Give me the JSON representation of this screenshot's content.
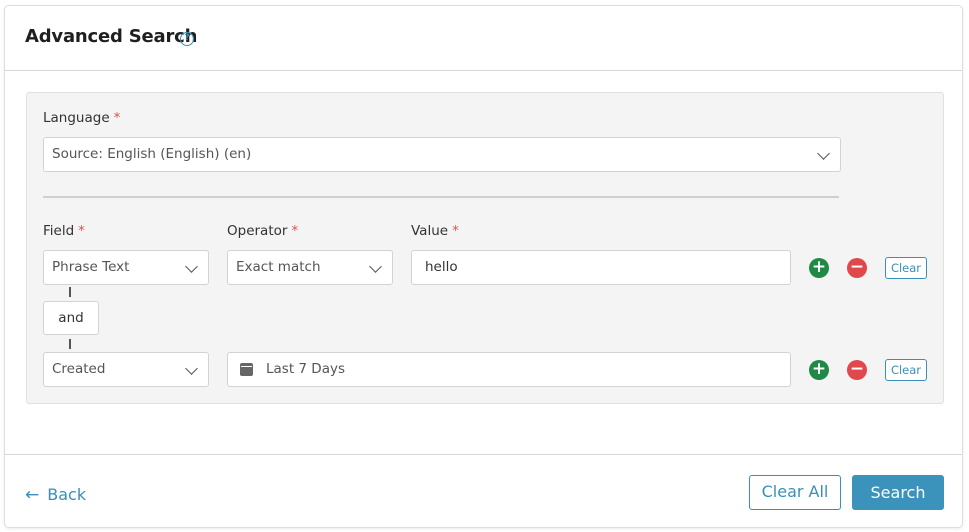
{
  "header": {
    "title": "Advanced Search",
    "help_icon": "?"
  },
  "language": {
    "label": "Language",
    "required_mark": "*",
    "value": "Source: English (English) (en)"
  },
  "columns": {
    "field": "Field",
    "operator": "Operator",
    "value": "Value",
    "required_mark": "*"
  },
  "rows": [
    {
      "field": "Phrase Text",
      "operator": "Exact match",
      "value": "hello",
      "add_icon": "+",
      "remove_icon": "−",
      "clear_label": "Clear"
    },
    {
      "field": "Created",
      "date_value": "Last 7 Days",
      "add_icon": "+",
      "remove_icon": "−",
      "clear_label": "Clear"
    }
  ],
  "connector": {
    "label": "and"
  },
  "footer": {
    "back_arrow": "←",
    "back_label": "Back",
    "clear_all_label": "Clear All",
    "search_label": "Search"
  },
  "colors": {
    "accent": "#3a8fb7",
    "add": "#1e8a45",
    "remove": "#e0484b",
    "required": "#d9534f"
  }
}
